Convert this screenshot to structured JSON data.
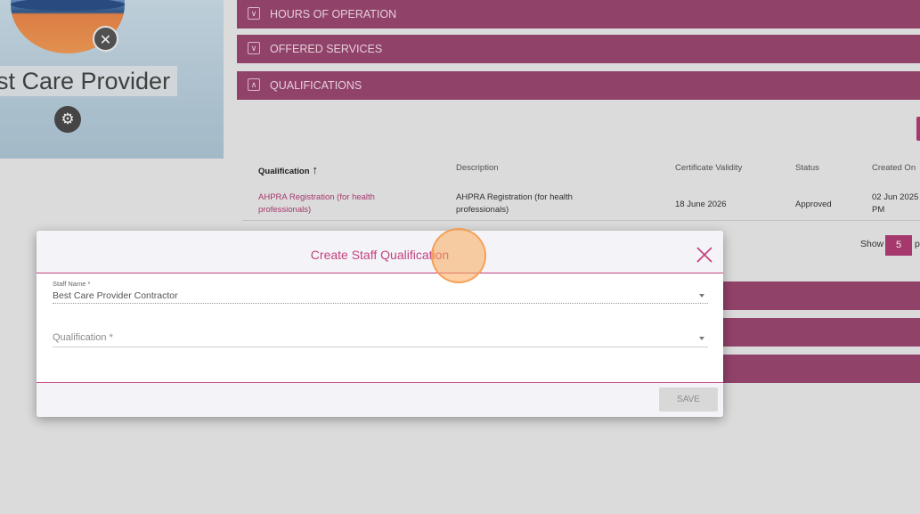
{
  "profile": {
    "provider_name": "st Care Provider",
    "remove_icon": "close-icon",
    "settings_icon": "gear-icon"
  },
  "sections": {
    "hours": "HOURS OF OPERATION",
    "services": "OFFERED SERVICES",
    "qualifications": "QUALIFICATIONS"
  },
  "table": {
    "headers": {
      "qualification": "Qualification",
      "description": "Description",
      "certificate_validity": "Certificate Validity",
      "status": "Status",
      "created_on": "Created On"
    },
    "rows": [
      {
        "qualification": "AHPRA Registration (for health professionals)",
        "description": "AHPRA Registration (for health professionals)",
        "certificate_validity": "18 June 2026",
        "status": "Approved",
        "created_on": "02 Jun 2025 PM"
      }
    ]
  },
  "pagination": {
    "show_label": "Show",
    "page_size": "5",
    "per_label": "p"
  },
  "modal": {
    "title": "Create Staff Qualification",
    "staff_name_label": "Staff Name *",
    "staff_name_value": "Best Care Provider Contractor",
    "qualification_placeholder": "Qualification *",
    "save_label": "SAVE"
  },
  "colors": {
    "accent": "#c2437d",
    "section_bar": "#9b4770"
  }
}
